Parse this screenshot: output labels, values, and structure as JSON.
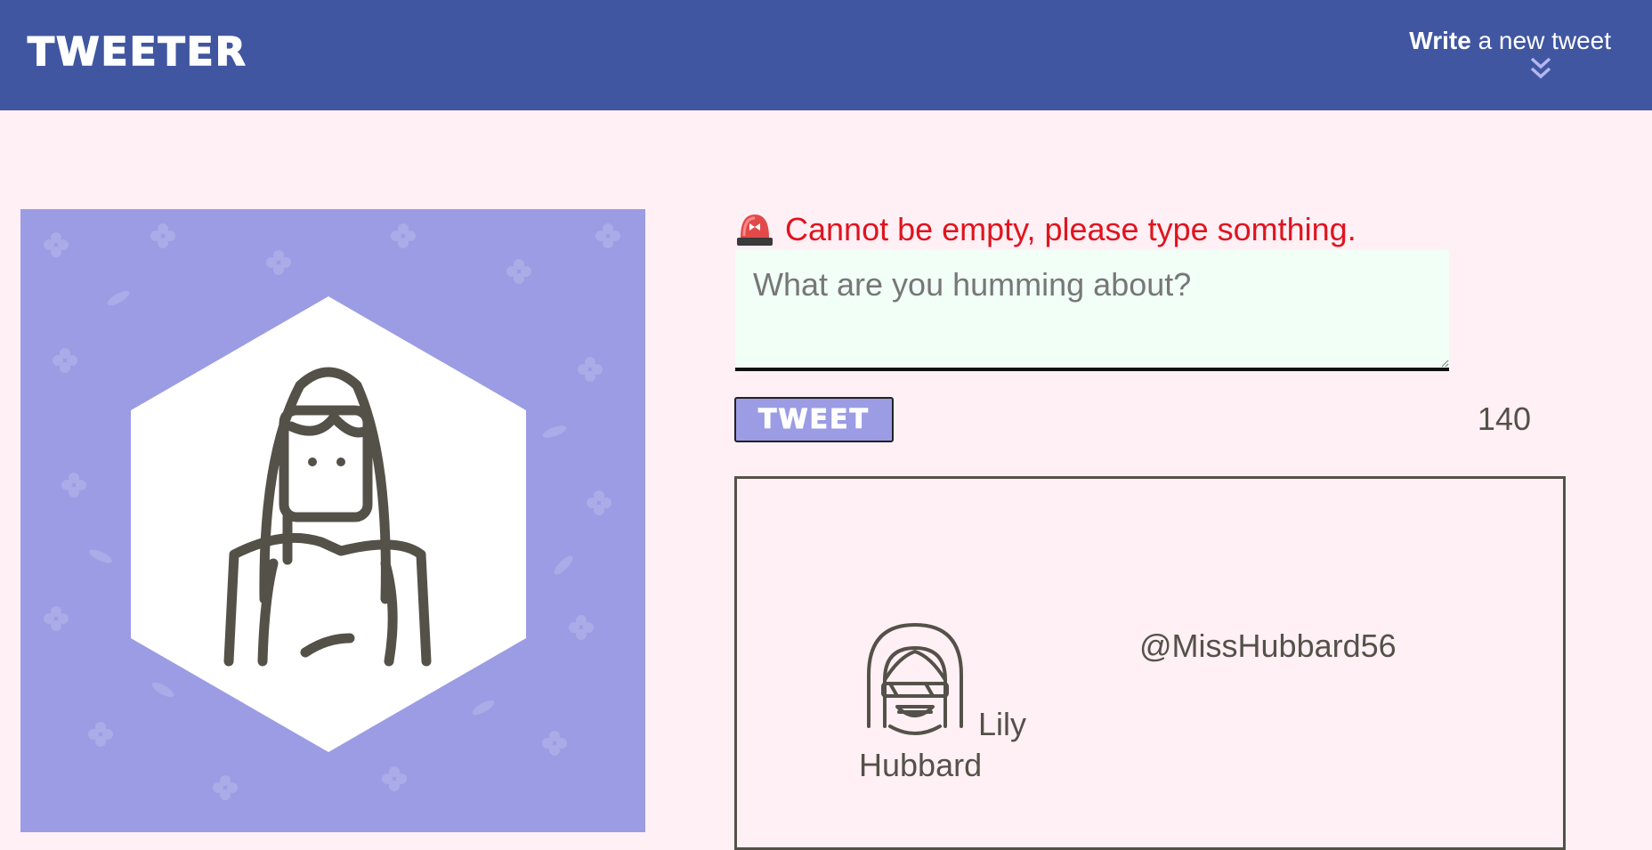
{
  "header": {
    "brand": "TWEETER",
    "compose_toggle_bold": "Write",
    "compose_toggle_rest": " a new tweet",
    "chevron_icon": "double-chevron-down-icon",
    "background_color": "#4056a1"
  },
  "profile": {
    "avatar_icon": "woman-avatar-icon",
    "card_color": "#9b9ce4"
  },
  "composer": {
    "error_icon": "siren-icon",
    "error_message": "Cannot be empty, please type somthing.",
    "placeholder": "What are you humming about?",
    "value": "",
    "submit_label": "TWEET",
    "char_counter": "140",
    "error_color": "#e0141e",
    "input_background": "#f1fff7"
  },
  "tweets": [
    {
      "avatar_icon": "sunglasses-avatar-icon",
      "name": "Lily Hubbard",
      "handle": "@MissHubbard56"
    }
  ]
}
